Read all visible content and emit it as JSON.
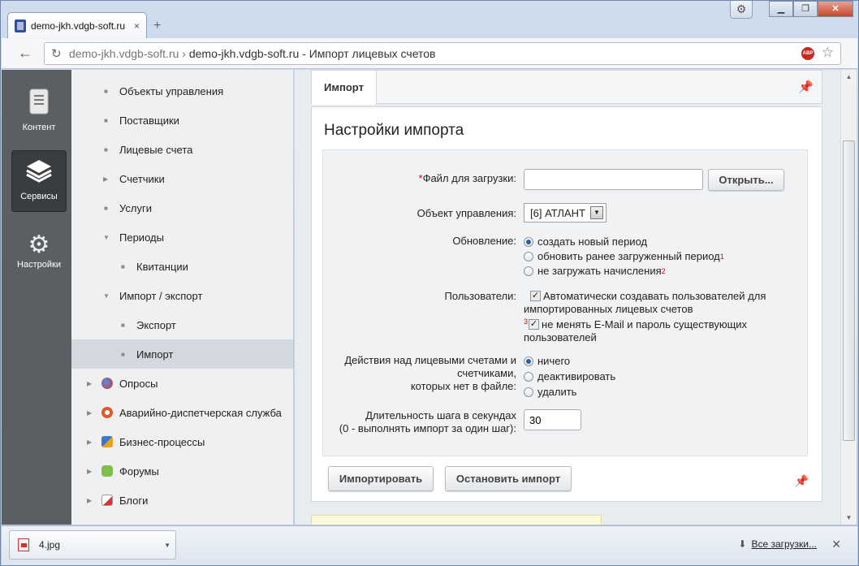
{
  "browser": {
    "tab_title": "demo-jkh.vdgb-soft.ru",
    "tab_close": "×",
    "new_tab": "+",
    "url_host": "demo-jkh.vdgb-soft.ru",
    "url_sep": "›",
    "url_title": "demo-jkh.vdgb-soft.ru - Импорт лицевых счетов",
    "abp": "ABP",
    "win_minimize": "▁",
    "win_restore": "❐",
    "win_close": "✕"
  },
  "iconpanel": {
    "items": [
      {
        "label": "Контент",
        "icon": "document-icon"
      },
      {
        "label": "Сервисы",
        "icon": "layers-icon"
      },
      {
        "label": "Настройки",
        "icon": "gear-icon"
      }
    ]
  },
  "menu": {
    "items": [
      {
        "label": "Объекты управления"
      },
      {
        "label": "Поставщики"
      },
      {
        "label": "Лицевые счета"
      },
      {
        "label": "Счетчики"
      },
      {
        "label": "Услуги"
      },
      {
        "label": "Периоды"
      },
      {
        "label": "Квитанции"
      },
      {
        "label": "Импорт / экспорт"
      },
      {
        "label": "Экспорт"
      },
      {
        "label": "Импорт"
      },
      {
        "label": "Опросы"
      },
      {
        "label": "Аварийно-диспетчерская служба"
      },
      {
        "label": "Бизнес-процессы"
      },
      {
        "label": "Форумы"
      },
      {
        "label": "Блоги"
      }
    ]
  },
  "content": {
    "tab": "Импорт",
    "heading": "Настройки импорта",
    "form": {
      "file_required_mark": "*",
      "file_label": "Файл для загрузки:",
      "file_value": "",
      "open_button": "Открыть...",
      "object_label": "Объект управления:",
      "object_value": "[6] АТЛАНТ",
      "update_label": "Обновление:",
      "update_options": [
        {
          "label": "создать новый период",
          "sup": ""
        },
        {
          "label": "обновить ранее загруженный период",
          "sup": "1"
        },
        {
          "label": "не загружать начисления",
          "sup": "2"
        }
      ],
      "users_label": "Пользователи:",
      "users_opt1_line1": "Автоматически создавать пользователей для",
      "users_opt1_line2": "импортированных лицевых счетов",
      "users_opt2_sup": "3",
      "users_opt2_line1": "не менять E-Mail и пароль существующих",
      "users_opt2_line2": "пользователей",
      "actions_label_1": "Действия над лицевыми счетами и",
      "actions_label_2": "счетчиками,",
      "actions_label_3": "которых нет в файле:",
      "actions_options": [
        {
          "label": "ничего"
        },
        {
          "label": "деактивировать"
        },
        {
          "label": "удалить"
        }
      ],
      "step_label_1": "Длительность шага в секундах",
      "step_label_2": "(0 - выполнять импорт за один шаг):",
      "step_value": "30"
    },
    "import_button": "Импортировать",
    "stop_button": "Остановить импорт"
  },
  "downloads": {
    "file": "4.jpg",
    "all": "Все загрузки...",
    "close": "✕"
  }
}
